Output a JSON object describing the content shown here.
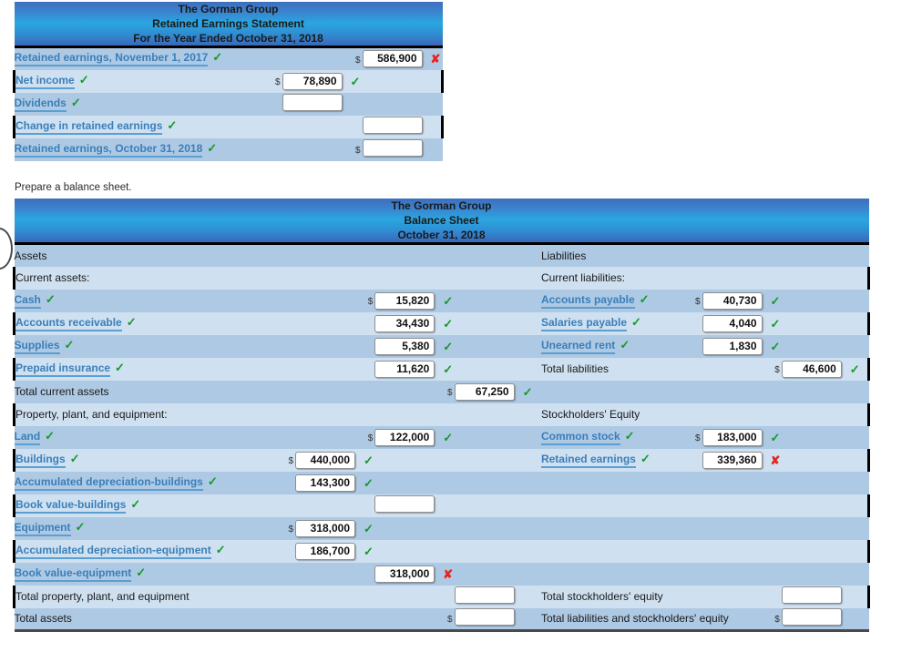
{
  "retained_earnings_statement": {
    "header": {
      "company": "The Gorman Group",
      "statement": "Retained Earnings Statement",
      "period": "For the Year Ended October 31, 2018"
    },
    "rows": [
      {
        "label": "Retained earnings, November 1, 2017",
        "label_mark": "check",
        "col": 2,
        "dollar": true,
        "value": "586,900",
        "mark": "cross"
      },
      {
        "label": "Net income",
        "label_mark": "check",
        "col": 1,
        "dollar": true,
        "value": "78,890",
        "mark": "check"
      },
      {
        "label": "Dividends",
        "label_mark": "check",
        "col": 1,
        "dollar": false,
        "value": "",
        "mark": "none"
      },
      {
        "label": "Change in retained earnings",
        "label_mark": "check",
        "col": 2,
        "dollar": false,
        "value": "",
        "mark": "none"
      },
      {
        "label": "Retained earnings, October 31, 2018",
        "label_mark": "check",
        "col": 2,
        "dollar": true,
        "value": "",
        "mark": "none"
      }
    ]
  },
  "prompt": "Prepare a balance sheet.",
  "balance_sheet": {
    "header": {
      "company": "The Gorman Group",
      "statement": "Balance Sheet",
      "date": "October 31, 2018"
    },
    "left": [
      {
        "label": "Assets",
        "style": "plain",
        "indent": 0,
        "mark": "none",
        "col": 0,
        "dollar": false,
        "value": "",
        "vmark": "none"
      },
      {
        "label": "Current assets:",
        "style": "plain",
        "indent": 0,
        "mark": "none",
        "col": 0,
        "dollar": false,
        "value": "",
        "vmark": "none"
      },
      {
        "label": "Cash",
        "style": "link",
        "indent": 1,
        "mark": "check",
        "col": 2,
        "dollar": true,
        "value": "15,820",
        "vmark": "check"
      },
      {
        "label": "Accounts receivable",
        "style": "link",
        "indent": 1,
        "mark": "check",
        "col": 2,
        "dollar": false,
        "value": "34,430",
        "vmark": "check"
      },
      {
        "label": "Supplies",
        "style": "link",
        "indent": 1,
        "mark": "check",
        "col": 2,
        "dollar": false,
        "value": "5,380",
        "vmark": "check"
      },
      {
        "label": "Prepaid insurance",
        "style": "link",
        "indent": 1,
        "mark": "check",
        "col": 2,
        "dollar": false,
        "value": "11,620",
        "vmark": "check"
      },
      {
        "label": "Total current assets",
        "style": "plain",
        "indent": 2,
        "mark": "none",
        "col": 3,
        "dollar": true,
        "value": "67,250",
        "vmark": "check"
      },
      {
        "label": "Property, plant, and equipment:",
        "style": "plain",
        "indent": 0,
        "mark": "none",
        "col": 0,
        "dollar": false,
        "value": "",
        "vmark": "none"
      },
      {
        "label": "Land",
        "style": "link",
        "indent": 1,
        "mark": "check",
        "col": 2,
        "dollar": true,
        "value": "122,000",
        "vmark": "check"
      },
      {
        "label": "Buildings",
        "style": "link",
        "indent": 1,
        "mark": "check",
        "col": 1,
        "dollar": true,
        "value": "440,000",
        "vmark": "check"
      },
      {
        "label": "Accumulated depreciation-buildings",
        "style": "link",
        "indent": 1,
        "mark": "check",
        "col": 1,
        "dollar": false,
        "value": "143,300",
        "vmark": "check"
      },
      {
        "label": "Book value-buildings",
        "style": "link",
        "indent": 1,
        "mark": "check",
        "col": 2,
        "dollar": false,
        "value": "",
        "vmark": "none"
      },
      {
        "label": "Equipment",
        "style": "link",
        "indent": 1,
        "mark": "check",
        "col": 1,
        "dollar": true,
        "value": "318,000",
        "vmark": "check"
      },
      {
        "label": "Accumulated depreciation-equipment",
        "style": "link",
        "indent": 1,
        "mark": "check",
        "col": 1,
        "dollar": false,
        "value": "186,700",
        "vmark": "check"
      },
      {
        "label": "Book value-equipment",
        "style": "link",
        "indent": 1,
        "mark": "check",
        "col": 2,
        "dollar": false,
        "value": "318,000",
        "vmark": "cross"
      },
      {
        "label": "Total property, plant, and equipment",
        "style": "plain",
        "indent": 2,
        "mark": "none",
        "col": 3,
        "dollar": false,
        "value": "",
        "vmark": "none"
      },
      {
        "label": "Total assets",
        "style": "plain",
        "indent": 0,
        "mark": "none",
        "col": 3,
        "dollar": true,
        "value": "",
        "vmark": "none"
      }
    ],
    "right": [
      {
        "label": "Liabilities",
        "style": "plain",
        "indent": 0,
        "mark": "none",
        "col": 0,
        "dollar": false,
        "value": "",
        "vmark": "none"
      },
      {
        "label": "Current liabilities:",
        "style": "plain",
        "indent": 0,
        "mark": "none",
        "col": 0,
        "dollar": false,
        "value": "",
        "vmark": "none"
      },
      {
        "label": "Accounts payable",
        "style": "link",
        "indent": 1,
        "mark": "check",
        "col": 1,
        "dollar": true,
        "value": "40,730",
        "vmark": "check"
      },
      {
        "label": "Salaries payable",
        "style": "link",
        "indent": 1,
        "mark": "check",
        "col": 1,
        "dollar": false,
        "value": "4,040",
        "vmark": "check"
      },
      {
        "label": "Unearned rent",
        "style": "link",
        "indent": 1,
        "mark": "check",
        "col": 1,
        "dollar": false,
        "value": "1,830",
        "vmark": "check"
      },
      {
        "label": "Total liabilities",
        "style": "plain",
        "indent": 1,
        "mark": "none",
        "col": 2,
        "dollar": true,
        "value": "46,600",
        "vmark": "check"
      },
      {
        "label": "",
        "style": "plain",
        "indent": 0,
        "mark": "none",
        "col": 0,
        "dollar": false,
        "value": "",
        "vmark": "none"
      },
      {
        "label": "Stockholders' Equity",
        "style": "plain",
        "indent": 1,
        "mark": "none",
        "col": 0,
        "dollar": false,
        "value": "",
        "vmark": "none"
      },
      {
        "label": "Common stock",
        "style": "link",
        "indent": 1,
        "mark": "check",
        "col": 1,
        "dollar": true,
        "value": "183,000",
        "vmark": "check"
      },
      {
        "label": "Retained earnings",
        "style": "link",
        "indent": 1,
        "mark": "check",
        "col": 1,
        "dollar": false,
        "value": "339,360",
        "vmark": "cross"
      },
      {
        "label": "",
        "style": "plain",
        "indent": 0,
        "mark": "none",
        "col": 0,
        "dollar": false,
        "value": "",
        "vmark": "none"
      },
      {
        "label": "",
        "style": "plain",
        "indent": 0,
        "mark": "none",
        "col": 0,
        "dollar": false,
        "value": "",
        "vmark": "none"
      },
      {
        "label": "",
        "style": "plain",
        "indent": 0,
        "mark": "none",
        "col": 0,
        "dollar": false,
        "value": "",
        "vmark": "none"
      },
      {
        "label": "",
        "style": "plain",
        "indent": 0,
        "mark": "none",
        "col": 0,
        "dollar": false,
        "value": "",
        "vmark": "none"
      },
      {
        "label": "",
        "style": "plain",
        "indent": 0,
        "mark": "none",
        "col": 0,
        "dollar": false,
        "value": "",
        "vmark": "none"
      },
      {
        "label": "Total stockholders' equity",
        "style": "plain",
        "indent": 1,
        "mark": "none",
        "col": 2,
        "dollar": false,
        "value": "",
        "vmark": "none"
      },
      {
        "label": "Total liabilities and stockholders' equity",
        "style": "plain",
        "indent": 1,
        "mark": "none",
        "col": 2,
        "dollar": true,
        "value": "",
        "vmark": "none"
      }
    ]
  },
  "glyphs": {
    "check": "✓",
    "cross": "✘",
    "dollar": "$"
  },
  "colors": {
    "check": "#159a28",
    "cross": "#e8231a",
    "link": "#3a7fba",
    "row_a": "#aec9e3",
    "row_b": "#cfe0f0",
    "header_blue": "#2aa6e0"
  }
}
